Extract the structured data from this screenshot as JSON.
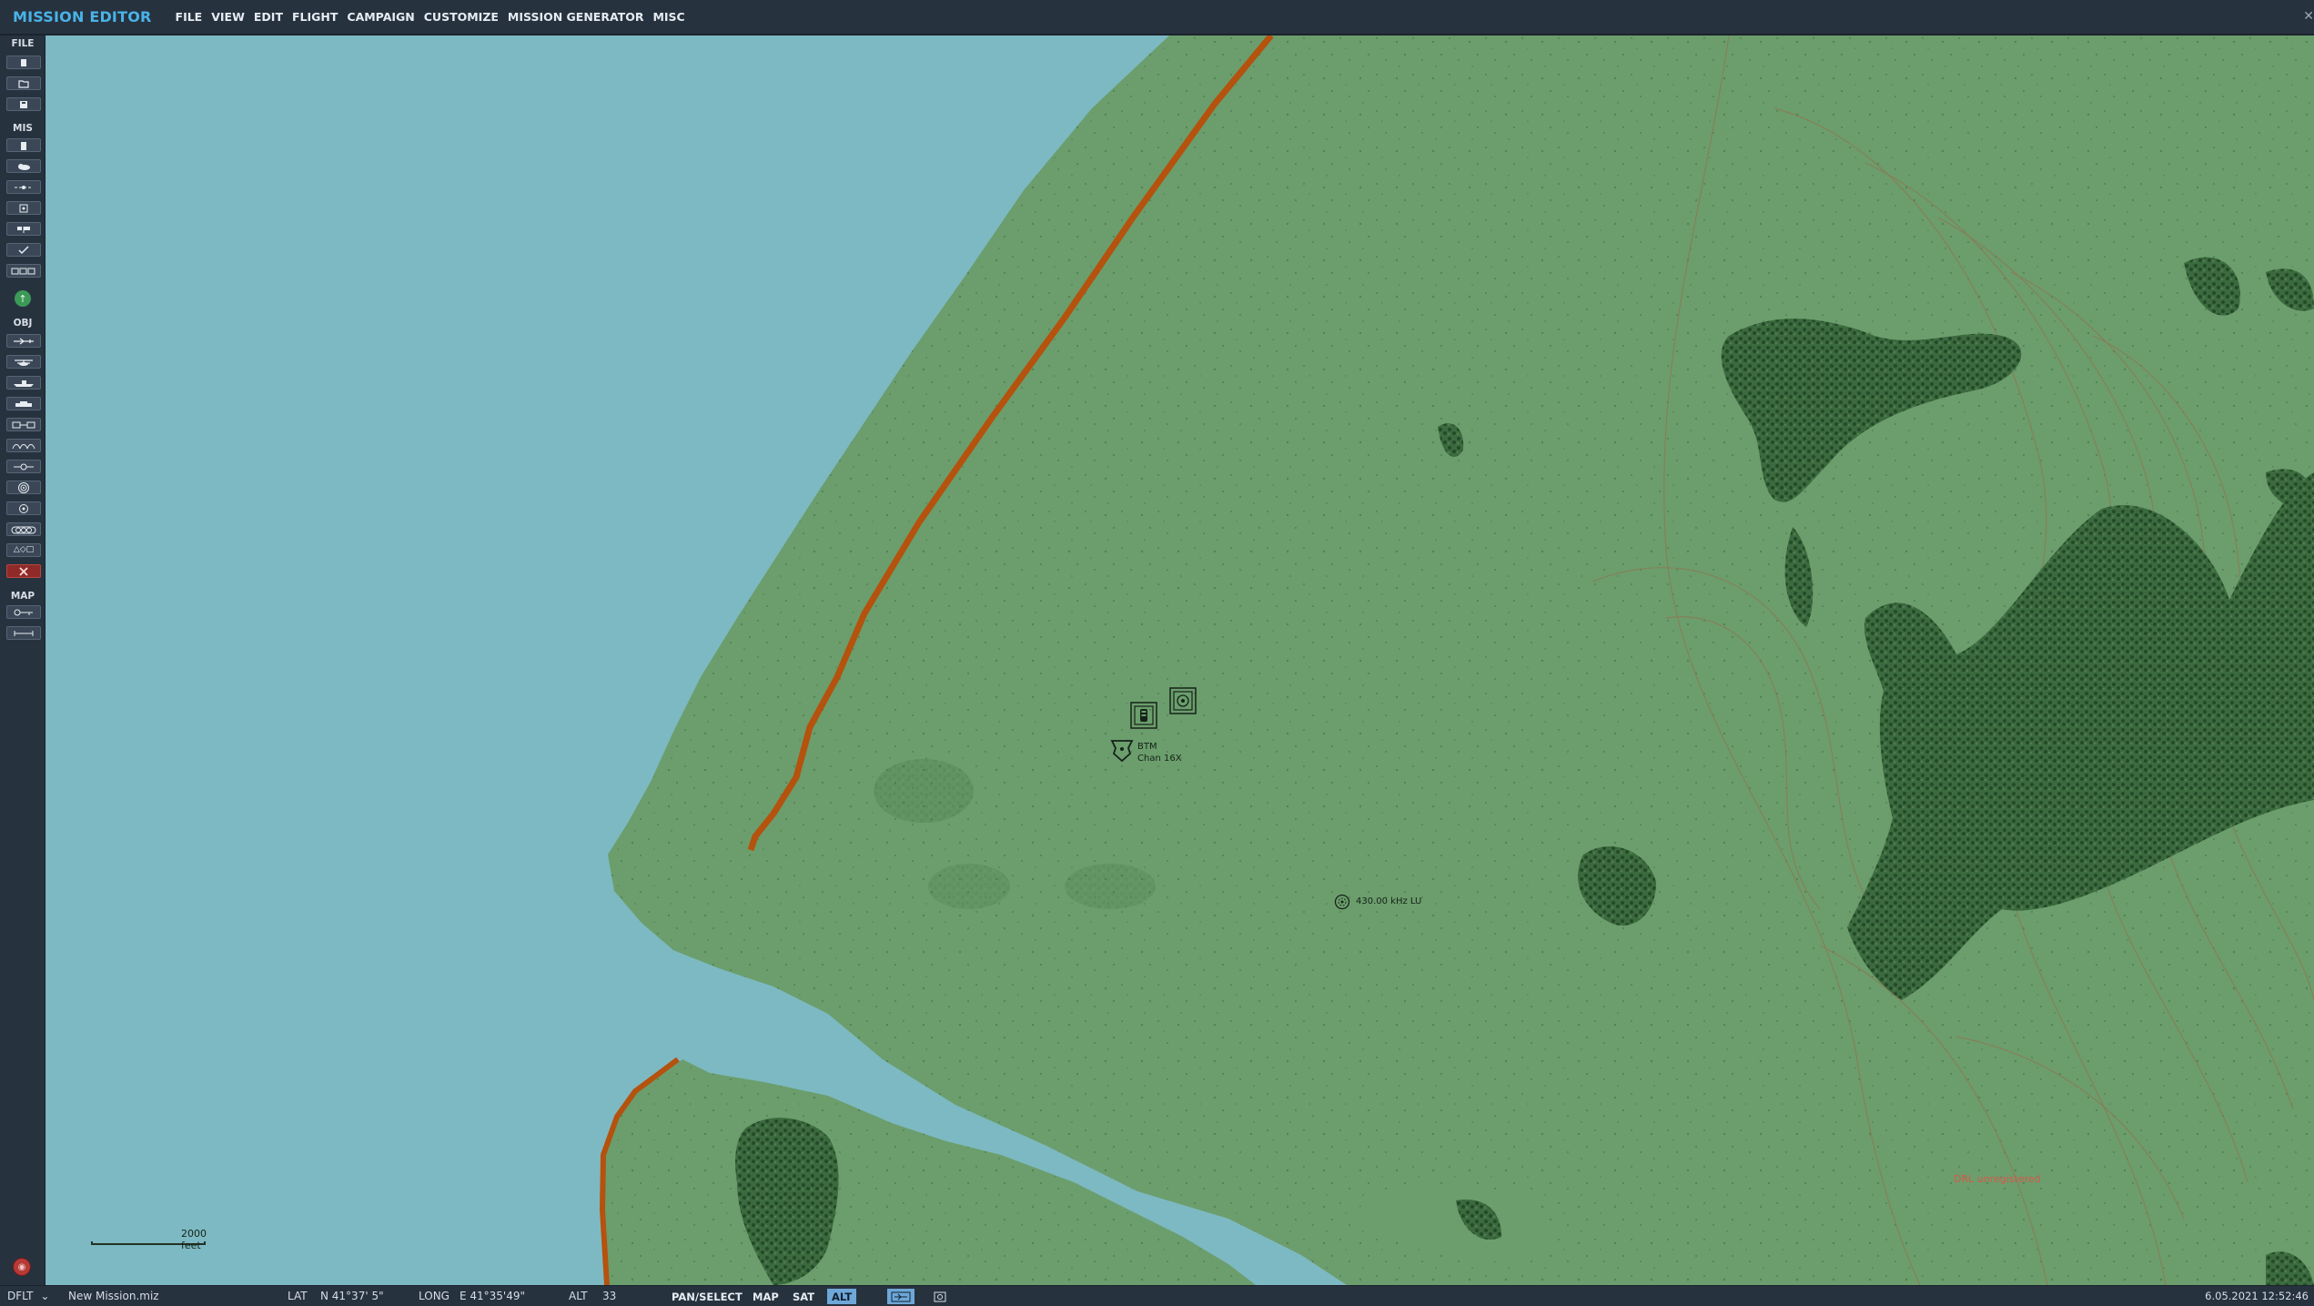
{
  "app": {
    "title": "MISSION EDITOR",
    "menu": [
      "FILE",
      "VIEW",
      "EDIT",
      "FLIGHT",
      "CAMPAIGN",
      "CUSTOMIZE",
      "MISSION GENERATOR",
      "MISC"
    ]
  },
  "toolbar": {
    "sections": {
      "file": "FILE",
      "mis": "MIS",
      "obj": "OBJ",
      "map": "MAP"
    },
    "file_buttons": [
      "new-file-icon",
      "open-folder-icon",
      "save-icon"
    ],
    "mis_buttons": [
      "clipboard-icon",
      "weather-icon",
      "route-icon",
      "target-icon",
      "flags-icon",
      "check-icon",
      "trigger-icon"
    ],
    "obj_buttons": [
      "plane-icon",
      "helicopter-icon",
      "ship-icon",
      "vehicle-icon",
      "static-object-icon",
      "group-icon",
      "waypoint-icon",
      "radar-icon",
      "beacon-icon",
      "formation-icon",
      "shapes-icon",
      "delete-icon"
    ],
    "obj_shapes_label": "△◇□",
    "map_buttons": [
      "map-key-icon",
      "ruler-icon"
    ]
  },
  "map": {
    "airbase_label_1": "BTM",
    "airbase_label_2": "Chan 16X",
    "ndb_label": "430.00 kHz LU",
    "scale_label": "2000 feet",
    "unregistered_text": "DRL unregistered",
    "colors": {
      "sea": "#7db9c2",
      "land": "#6b9e6c",
      "coast": "#b4520e",
      "forest": "#2f5a33",
      "contour": "#8e7653"
    }
  },
  "status": {
    "profile": "DFLT",
    "profile_caret": "⌄",
    "file": "New Mission.miz",
    "lat_label": "LAT",
    "lat_value": "N 41°37' 5\"",
    "long_label": "LONG",
    "long_value": "E 41°35'49\"",
    "alt_label": "ALT",
    "alt_value": "33",
    "mode_pan": "PAN/SELECT",
    "mode_map": "MAP",
    "mode_sat": "SAT",
    "mode_alt": "ALT",
    "datetime": "6.05.2021 12:52:46"
  }
}
